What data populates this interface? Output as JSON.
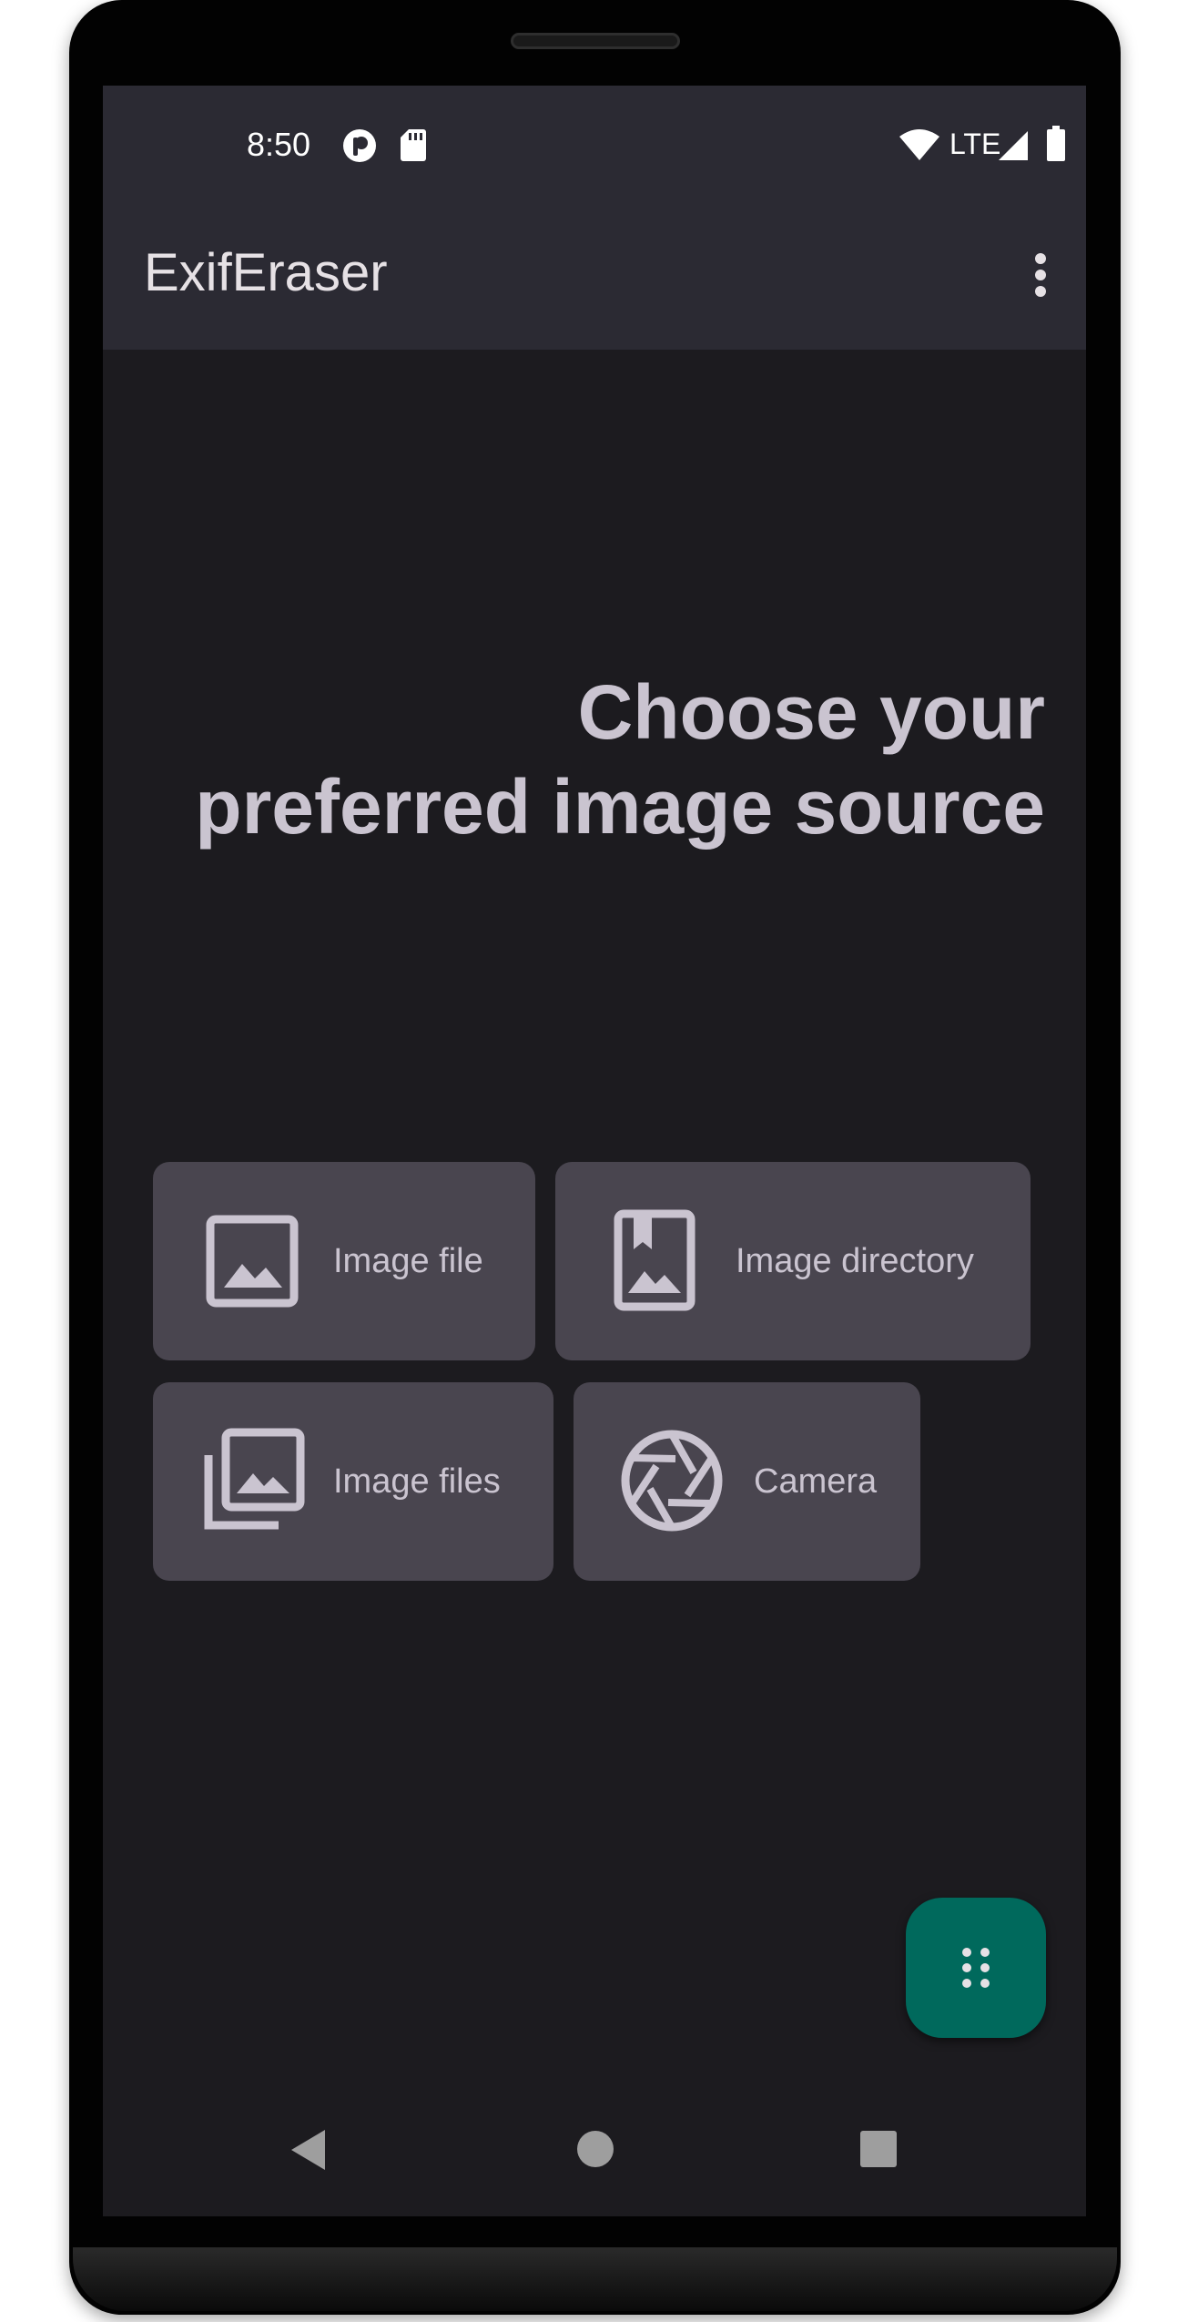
{
  "status_bar": {
    "time": "8:50",
    "network_label": "LTE",
    "icons": [
      "app-notification-icon",
      "sd-card-icon",
      "wifi-icon",
      "signal-icon",
      "battery-icon"
    ]
  },
  "app_bar": {
    "title": "ExifEraser",
    "overflow_icon": "more-vert-icon"
  },
  "main": {
    "heading_line1": "Choose your",
    "heading_line2": "preferred image source",
    "sources": [
      {
        "label": "Image file",
        "icon": "image-icon"
      },
      {
        "label": "Image directory",
        "icon": "bookmark-image-icon"
      },
      {
        "label": "Image files",
        "icon": "image-stack-icon"
      },
      {
        "label": "Camera",
        "icon": "camera-aperture-icon"
      }
    ]
  },
  "fab": {
    "icon": "dots-grid-icon"
  },
  "nav_bar": {
    "icons": [
      "back-icon",
      "home-icon",
      "recents-icon"
    ]
  },
  "colors": {
    "surface": "#1c1b1f",
    "app_bar": "#2b2a33",
    "card": "#49454f",
    "on_surface": "#cac4d0",
    "fab": "#00695c"
  }
}
